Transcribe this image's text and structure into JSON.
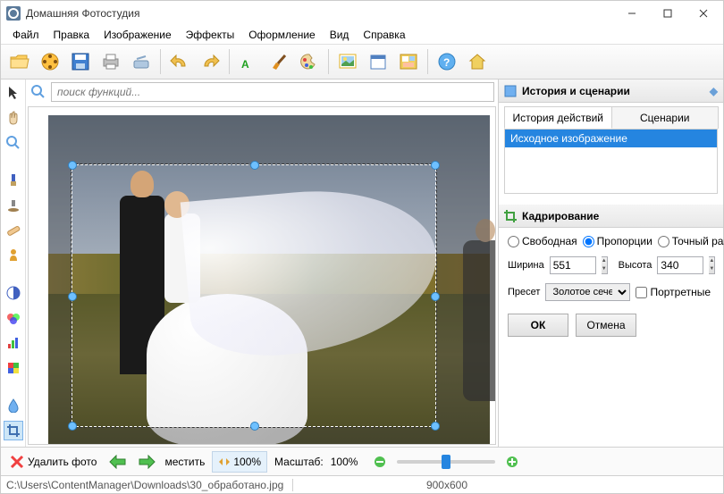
{
  "title": "Домашняя Фотостудия",
  "menu": {
    "file": "Файл",
    "edit": "Правка",
    "image": "Изображение",
    "effects": "Эффекты",
    "decorate": "Оформление",
    "view": "Вид",
    "help": "Справка"
  },
  "search": {
    "placeholder": "поиск функций..."
  },
  "right": {
    "history_title": "История и сценарии",
    "tab_history": "История действий",
    "tab_scenarios": "Сценарии",
    "history_item": "Исходное изображение",
    "crop_title": "Кадрирование",
    "mode_free": "Свободная",
    "mode_prop": "Пропорции",
    "mode_exact": "Точный размер",
    "width_label": "Ширина",
    "width_value": "551",
    "height_label": "Высота",
    "height_value": "340",
    "preset_label": "Пресет",
    "preset_value": "Золотое сечение",
    "portrait": "Портретные",
    "ok": "ОК",
    "cancel": "Отмена"
  },
  "bottom": {
    "delete": "Удалить фото",
    "move": "местить",
    "fit": "100%",
    "scale_label": "Масштаб:",
    "scale_value": "100%"
  },
  "status": {
    "path": "C:\\Users\\ContentManager\\Downloads\\30_обработано.jpg",
    "dims": "900x600"
  }
}
